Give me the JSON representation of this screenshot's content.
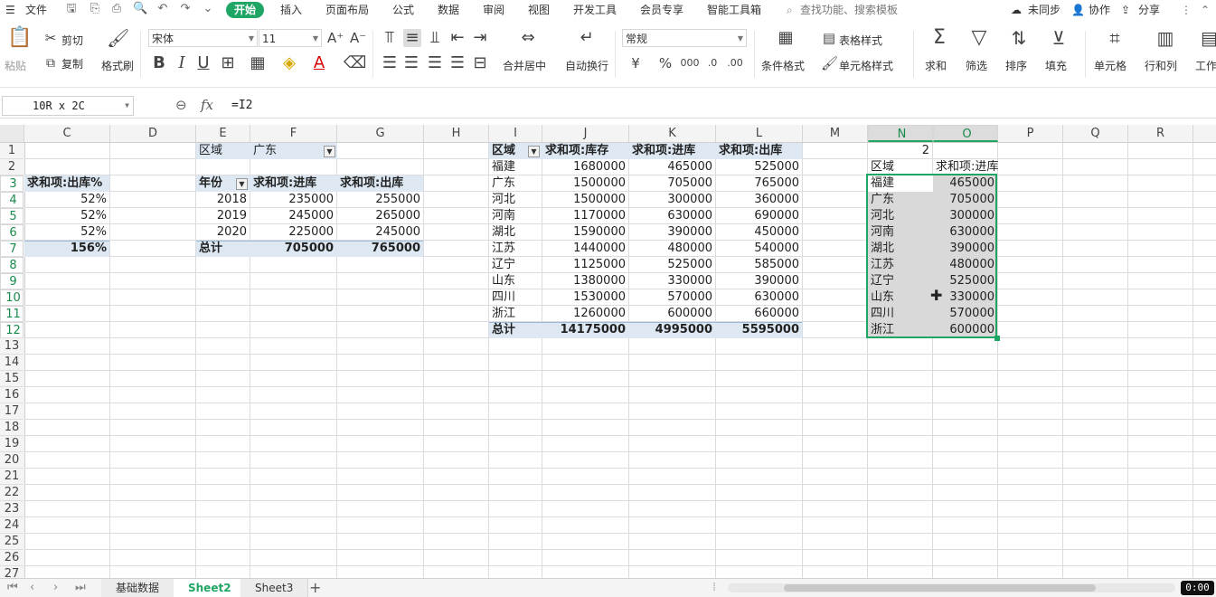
{
  "menubar": {
    "file_label": "文件",
    "tabs": [
      "开始",
      "插入",
      "页面布局",
      "公式",
      "数据",
      "审阅",
      "视图",
      "开发工具",
      "会员专享",
      "智能工具箱"
    ],
    "search_placeholder": "查找功能、搜索模板",
    "sync_label": "未同步",
    "collab_label": "协作",
    "share_label": "分享"
  },
  "ribbon": {
    "paste_label": "粘贴",
    "cut_label": "剪切",
    "copy_label": "复制",
    "format_painter_label": "格式刷",
    "font_name": "宋体",
    "font_size": "11",
    "merge_label": "合并居中",
    "wrap_label": "自动换行",
    "number_format": "常规",
    "currency_symbol": "¥",
    "percent_symbol": "%",
    "conditional_label": "条件格式",
    "table_style_label": "表格样式",
    "cell_style_label": "单元格样式",
    "sum_label": "求和",
    "filter_label": "筛选",
    "sort_label": "排序",
    "fill_label": "填充",
    "cell_label": "单元格",
    "rowcol_label": "行和列",
    "worksheet_label": "工作"
  },
  "formula_bar": {
    "name_box": "10R x 2C",
    "fx": "fx",
    "formula": "=I2"
  },
  "columns": [
    "C",
    "D",
    "E",
    "F",
    "G",
    "H",
    "I",
    "J",
    "K",
    "L",
    "M",
    "N",
    "O",
    "P",
    "Q",
    "R"
  ],
  "rows": [
    "1",
    "2",
    "3",
    "4",
    "5",
    "6",
    "7",
    "8",
    "9",
    "10",
    "11",
    "12",
    "13",
    "14",
    "15",
    "16",
    "17",
    "18",
    "19",
    "20",
    "21",
    "22",
    "23",
    "24",
    "25",
    "26",
    "27"
  ],
  "pivot_c": {
    "header": "求和项:出库%",
    "values": [
      "52%",
      "52%",
      "52%"
    ],
    "total": "156%"
  },
  "pivot_ef": {
    "filter_label": "区域",
    "filter_value": "广东",
    "headers": [
      "年份",
      "求和项:进库",
      "求和项:出库"
    ],
    "rows": [
      [
        "2018",
        "235000",
        "255000"
      ],
      [
        "2019",
        "245000",
        "265000"
      ],
      [
        "2020",
        "225000",
        "245000"
      ]
    ],
    "total": [
      "总计",
      "705000",
      "765000"
    ]
  },
  "pivot_il": {
    "headers": [
      "区域",
      "求和项:库存",
      "求和项:进库",
      "求和项:出库"
    ],
    "rows": [
      [
        "福建",
        "1680000",
        "465000",
        "525000"
      ],
      [
        "广东",
        "1500000",
        "705000",
        "765000"
      ],
      [
        "河北",
        "1500000",
        "300000",
        "360000"
      ],
      [
        "河南",
        "1170000",
        "630000",
        "690000"
      ],
      [
        "湖北",
        "1590000",
        "390000",
        "450000"
      ],
      [
        "江苏",
        "1440000",
        "480000",
        "540000"
      ],
      [
        "辽宁",
        "1125000",
        "525000",
        "585000"
      ],
      [
        "山东",
        "1380000",
        "330000",
        "390000"
      ],
      [
        "四川",
        "1530000",
        "570000",
        "630000"
      ],
      [
        "浙江",
        "1260000",
        "600000",
        "660000"
      ]
    ],
    "total": [
      "总计",
      "14175000",
      "4995000",
      "5595000"
    ]
  },
  "copy_no": {
    "n1": "2",
    "headers": [
      "区域",
      "求和项:进库"
    ],
    "rows": [
      [
        "福建",
        "465000"
      ],
      [
        "广东",
        "705000"
      ],
      [
        "河北",
        "300000"
      ],
      [
        "河南",
        "630000"
      ],
      [
        "湖北",
        "390000"
      ],
      [
        "江苏",
        "480000"
      ],
      [
        "辽宁",
        "525000"
      ],
      [
        "山东",
        "330000"
      ],
      [
        "四川",
        "570000"
      ],
      [
        "浙江",
        "600000"
      ]
    ]
  },
  "sheet_tabs": [
    "基础数据",
    "Sheet2",
    "Sheet3"
  ],
  "active_sheet": "Sheet2",
  "timer": "0:00",
  "colors": {
    "accent": "#1fa564",
    "pivot_band": "#dde8f3",
    "selection_gray": "#d9d9d9"
  }
}
